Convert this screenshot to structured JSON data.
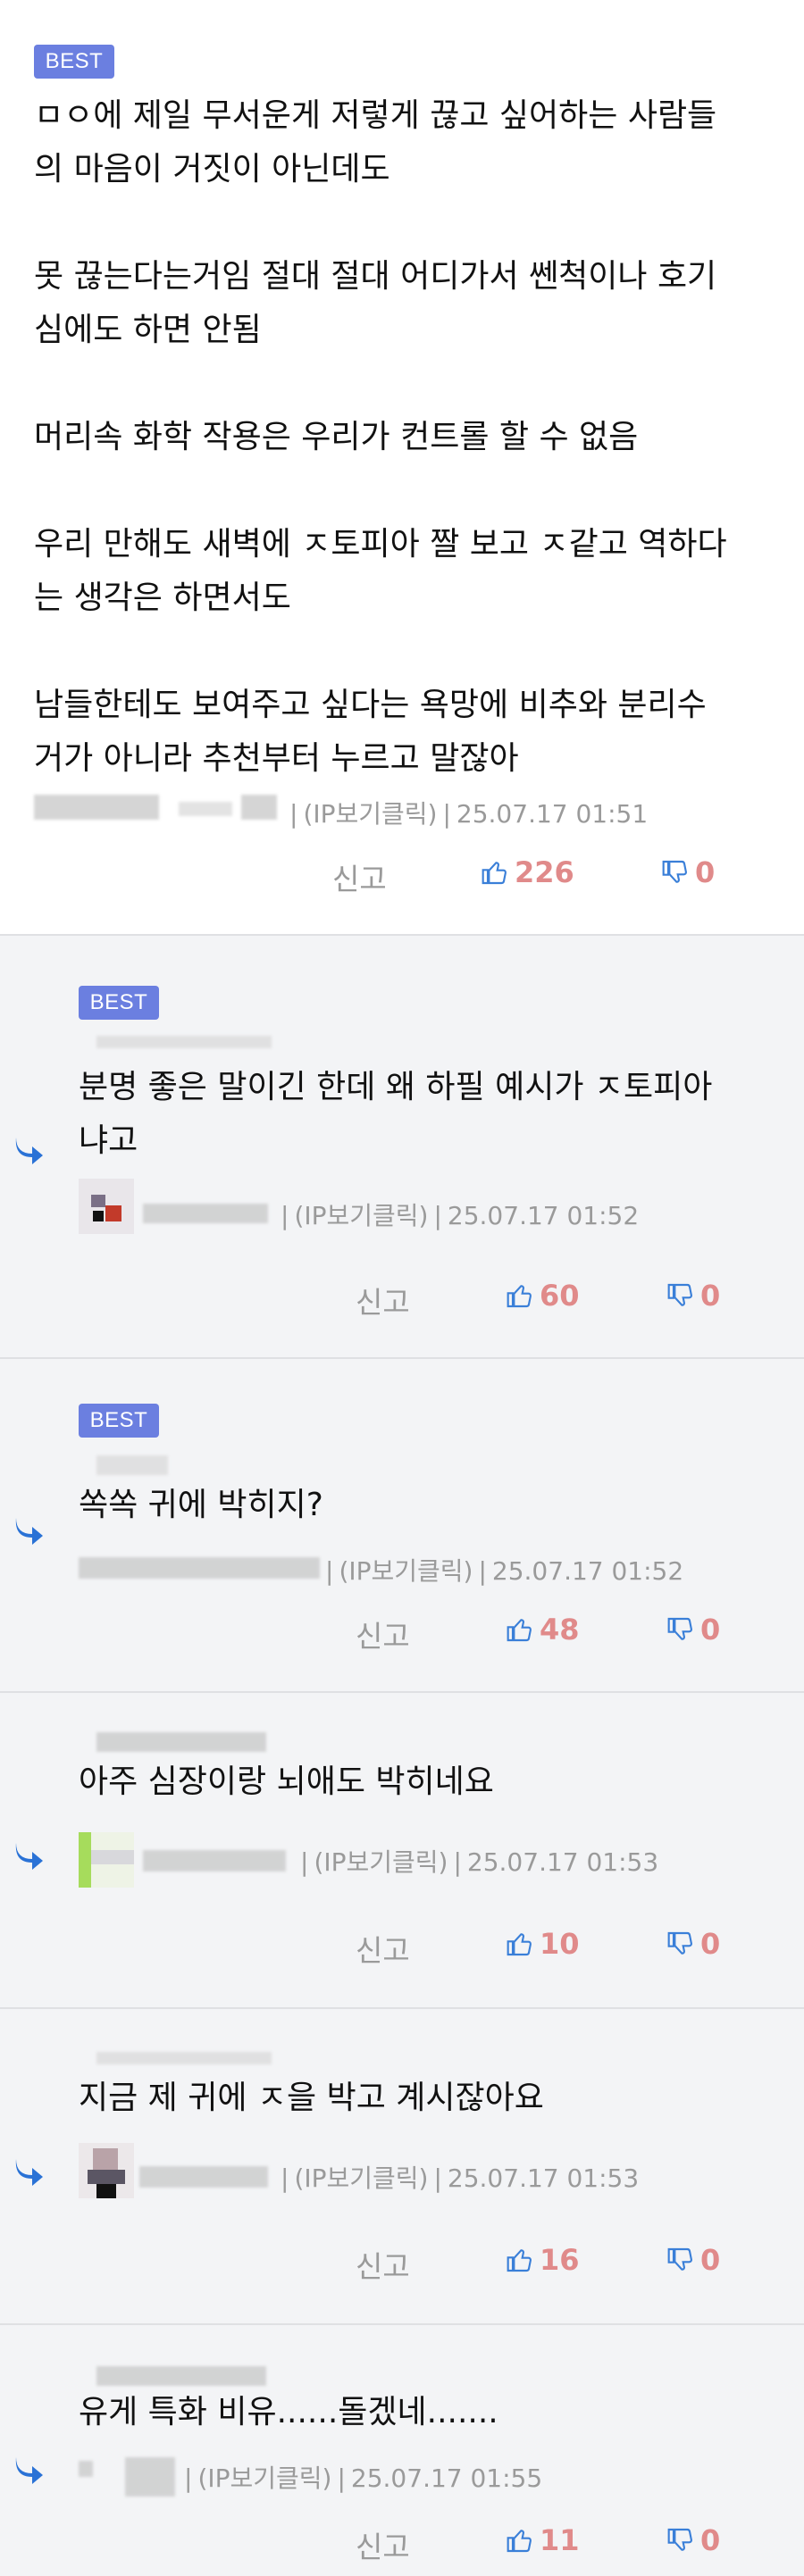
{
  "best_label": "BEST",
  "report_label": "신고",
  "ip_label": "(IP보기클릭)",
  "main_comment": {
    "paragraphs": [
      "ㅁㅇ에 제일 무서운게 저렇게 끊고 싶어하는 사람들\n의 마음이 거짓이 아닌데도",
      "못 끊는다는거임 절대 절대 어디가서 쎈척이나 호기\n심에도 하면 안됨",
      "머리속 화학 작용은 우리가 컨트롤 할 수 없음",
      "우리 만해도 새벽에 ㅈ토피아 짤 보고 ㅈ같고 역하다\n는 생각은 하면서도",
      "남들한테도 보여주고 싶다는 욕망에 비추와 분리수\n거가 아니라 추천부터 누르고 말잖아"
    ],
    "timestamp": "25.07.17 01:51",
    "likes": "226",
    "dislikes": "0"
  },
  "replies": [
    {
      "best": true,
      "text": "분명 좋은 말이긴 한데 왜 하필 예시가 ㅈ토피아\n냐고",
      "timestamp": "25.07.17 01:52",
      "likes": "60",
      "dislikes": "0"
    },
    {
      "best": true,
      "text": "쏙쏙 귀에 박히지?",
      "timestamp": "25.07.17 01:52",
      "likes": "48",
      "dislikes": "0"
    },
    {
      "best": false,
      "text": "아주 심장이랑 뇌애도 박히네요",
      "timestamp": "25.07.17 01:53",
      "likes": "10",
      "dislikes": "0"
    },
    {
      "best": false,
      "text": "지금 제 귀에 ㅈ을 박고 계시잖아요",
      "timestamp": "25.07.17 01:53",
      "likes": "16",
      "dislikes": "0"
    },
    {
      "best": false,
      "text": "유게 특화 비유......돌겠네.......",
      "timestamp": "25.07.17 01:55",
      "likes": "11",
      "dislikes": "0"
    }
  ],
  "colors": {
    "best_badge": "#6b7fe0",
    "like": "#e08a8a",
    "reply_bg": "#f3f4f6",
    "reply_arrow": "#2a72d6"
  },
  "icons": [
    "thumbs-up-icon",
    "thumbs-down-icon",
    "reply-arrow-icon"
  ]
}
